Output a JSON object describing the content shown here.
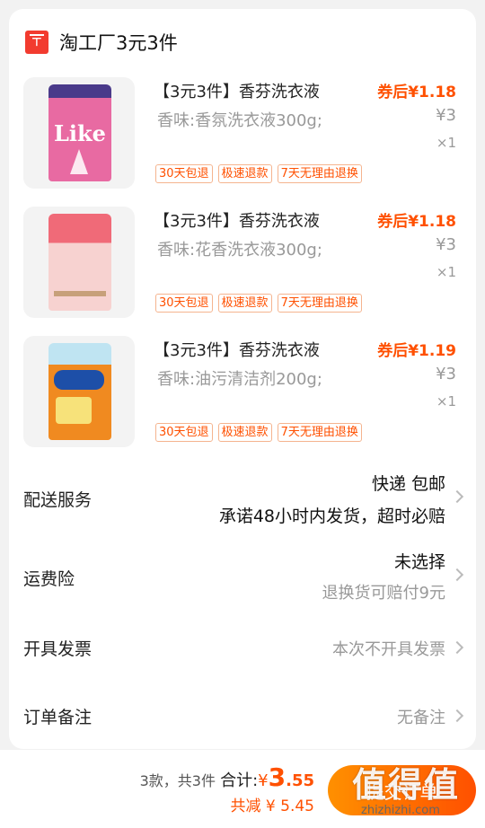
{
  "shop": {
    "name": "淘工厂3元3件"
  },
  "items": [
    {
      "title": "【3元3件】香芬洗衣液",
      "spec": "香味:香氛洗衣液300g;",
      "price_after_coupon": "券后¥1.18",
      "price": "¥3",
      "qty": "×1",
      "thumb_text": "Like"
    },
    {
      "title": "【3元3件】香芬洗衣液",
      "spec": "香味:花香洗衣液300g;",
      "price_after_coupon": "券后¥1.18",
      "price": "¥3",
      "qty": "×1"
    },
    {
      "title": "【3元3件】香芬洗衣液",
      "spec": "香味:油污清洁剂200g;",
      "price_after_coupon": "券后¥1.19",
      "price": "¥3",
      "qty": "×1"
    }
  ],
  "tags": [
    "30天包退",
    "极速退款",
    "7天无理由退换"
  ],
  "delivery": {
    "label": "配送服务",
    "value": "快递 包邮",
    "note": "承诺48小时内发货，超时必赔"
  },
  "shipping_insurance": {
    "label": "运费险",
    "value": "未选择",
    "note": "退换货可赔付9元"
  },
  "invoice": {
    "label": "开具发票",
    "value": "本次不开具发票"
  },
  "remark": {
    "label": "订单备注",
    "value": "无备注"
  },
  "footer": {
    "count_text": "3款，共3件",
    "total_label": "合计:",
    "currency": "¥",
    "total_int": "3",
    "total_dec": ".55",
    "discount_text": "共减 ¥ 5.45",
    "submit_label": "提交订单"
  },
  "watermark": {
    "text": "值得值",
    "url": "zhizhizhi.com"
  },
  "colors": {
    "accent": "#ff5000",
    "brand_red": "#f23b2f"
  }
}
